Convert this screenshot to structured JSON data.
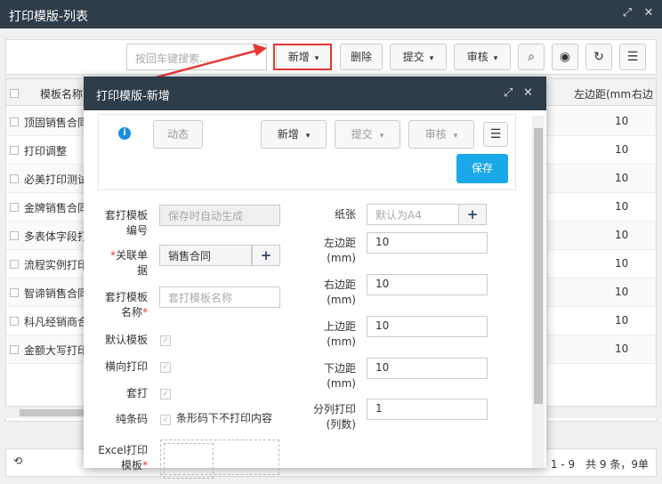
{
  "window": {
    "title": "打印模版-列表"
  },
  "toolbar": {
    "search_placeholder": "按回车键搜索...",
    "add_label": "新增",
    "delete_label": "删除",
    "submit_label": "提交",
    "review_label": "审核"
  },
  "grid": {
    "headers": {
      "name": "模板名称",
      "left_margin": "左边距(mm",
      "right_margin": "右边"
    },
    "rows": [
      {
        "name": "顶固销售合同",
        "value": "10"
      },
      {
        "name": "打印调整",
        "value": "10"
      },
      {
        "name": "必美打印测试",
        "value": "10"
      },
      {
        "name": "金牌销售合同",
        "value": "10"
      },
      {
        "name": "多表体字段打",
        "value": "10"
      },
      {
        "name": "流程实例打印",
        "value": "10"
      },
      {
        "name": "智谛销售合同",
        "value": "10"
      },
      {
        "name": "科凡经销商合",
        "value": "10"
      },
      {
        "name": "金额大写打印",
        "value": "10"
      }
    ]
  },
  "pager": {
    "refresh_icon": "refresh-icon",
    "info": "1 - 9　共 9 条，9单"
  },
  "modal": {
    "title": "打印模版-新增",
    "toolbar": {
      "dynamic_label": "动态",
      "add_label": "新增",
      "submit_label": "提交",
      "review_label": "审核",
      "save_label": "保存"
    },
    "form": {
      "template_code_label": "套打模板编号",
      "template_code_value": "保存时自动生成",
      "related_doc_label": "关联单据",
      "related_doc_value": "销售合同",
      "template_name_label": "套打模板名称",
      "template_name_placeholder": "套打模板名称",
      "default_template_label": "默认模板",
      "landscape_label": "横向打印",
      "overlay_label": "套打",
      "barcode_label": "纯条码",
      "barcode_option": "条形码下不打印内容",
      "excel_label": "Excel打印模板",
      "paper_label": "纸张",
      "paper_placeholder": "默认为A4",
      "left_margin_label": "左边距(mm)",
      "left_margin_value": "10",
      "right_margin_label": "右边距(mm)",
      "right_margin_value": "10",
      "top_margin_label": "上边距(mm)",
      "top_margin_value": "10",
      "bottom_margin_label": "下边距(mm)",
      "bottom_margin_value": "10",
      "columns_label": "分列打印(列数)",
      "columns_value": "1"
    }
  },
  "colors": {
    "header_bg": "#2f3d4a",
    "accent": "#1aa8e8",
    "highlight": "#e53935"
  }
}
